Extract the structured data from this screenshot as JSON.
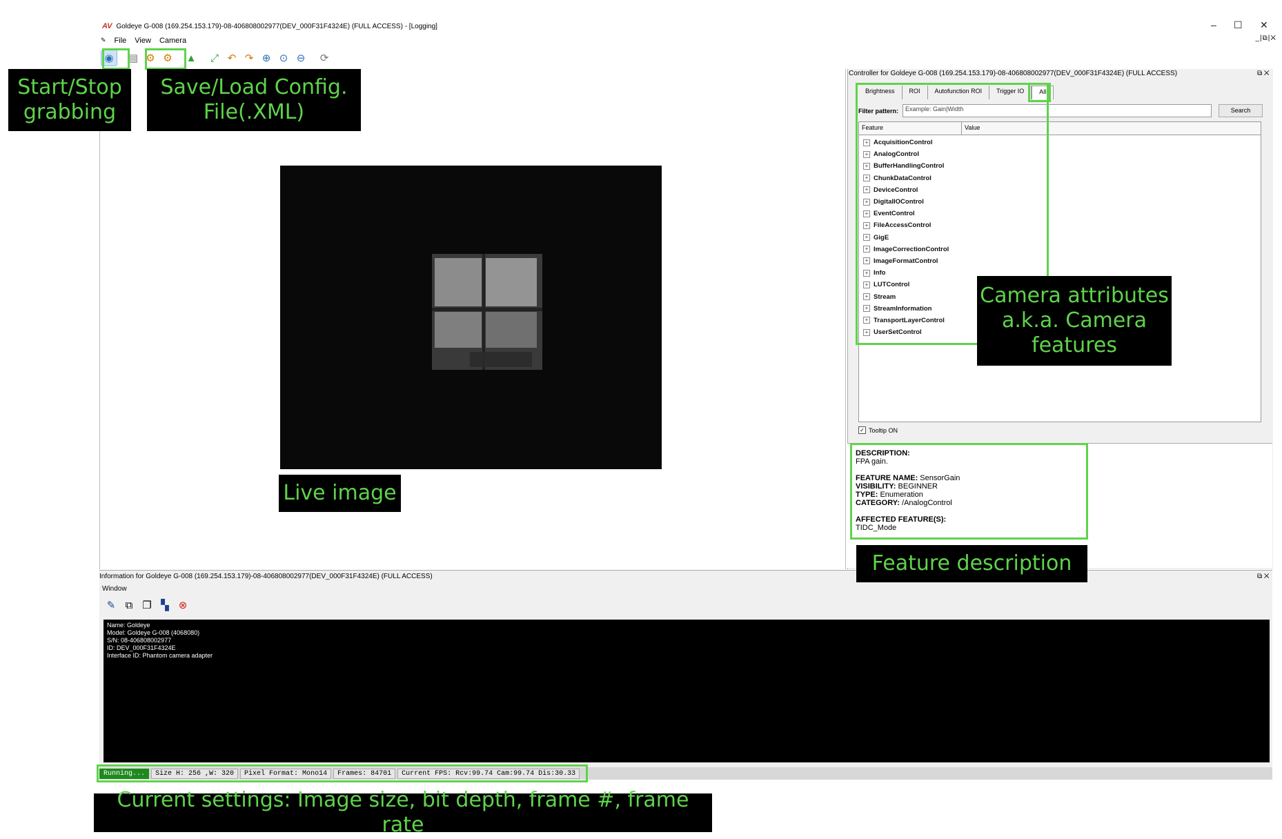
{
  "window": {
    "title": "Goldeye G-008 (169.254.153.179)-08-406808002977(DEV_000F31F4324E) (FULL ACCESS) - [Logging]",
    "controls": [
      "–",
      "☐",
      "✕"
    ],
    "mdi_controls": "_|⧉|✕"
  },
  "menu": {
    "items": [
      "File",
      "View",
      "Camera"
    ]
  },
  "controller": {
    "title": "Controller for Goldeye G-008 (169.254.153.179)-08-406808002977(DEV_000F31F4324E) (FULL ACCESS)",
    "dock": "⧉ ✕",
    "tabs": [
      "Brightness",
      "ROI",
      "Autofunction ROI",
      "Trigger IO",
      "All"
    ],
    "filter_label": "Filter pattern:",
    "filter_placeholder": "Example: Gain|Width",
    "search_label": "Search",
    "col_feature": "Feature",
    "col_value": "Value",
    "features": [
      "AcquisitionControl",
      "AnalogControl",
      "BufferHandlingControl",
      "ChunkDataControl",
      "DeviceControl",
      "DigitalIOControl",
      "EventControl",
      "FileAccessControl",
      "GigE",
      "ImageCorrectionControl",
      "ImageFormatControl",
      "Info",
      "LUTControl",
      "Stream",
      "StreamInformation",
      "TransportLayerControl",
      "UserSetControl"
    ],
    "tooltip_label": "Tooltip ON"
  },
  "description": {
    "desc_label": "DESCRIPTION:",
    "desc_value": "FPA gain.",
    "name_label": "FEATURE NAME:",
    "name_value": "SensorGain",
    "vis_label": "VISIBILITY:",
    "vis_value": "BEGINNER",
    "type_label": "TYPE:",
    "type_value": "Enumeration",
    "cat_label": "CATEGORY:",
    "cat_value": "/AnalogControl",
    "aff_label": "AFFECTED FEATURE(S):",
    "aff_value": "TIDC_Mode"
  },
  "info": {
    "title": "Information for Goldeye G-008 (169.254.153.179)-08-406808002977(DEV_000F31F4324E) (FULL ACCESS)",
    "window_menu": "Window",
    "console_lines": [
      "Name: Goldeye",
      "Model: Goldeye G-008 (4068080)",
      "S/N: 08-406808002977",
      "ID: DEV_000F31F4324E",
      "Interface ID: Phantom camera adapter"
    ]
  },
  "status": {
    "running": "Running...",
    "size": "Size H: 256 ,W: 320",
    "format": "Pixel Format: Mono14",
    "frames": "Frames: 84701",
    "fps": "Current FPS: Rcv:99.74 Cam:99.74 Dis:30.33"
  },
  "annotations": {
    "start_stop": "Start/Stop grabbing",
    "save_load": "Save/Load Config. File(.XML)",
    "camera_attr": "Camera attributes a.k.a. Camera features",
    "live": "Live image",
    "feature_desc": "Feature description",
    "current_settings": "Current settings: Image size, bit depth, frame #, frame rate"
  },
  "colors": {
    "annotation": "#5fd34b",
    "running": "#1e8a1e"
  }
}
